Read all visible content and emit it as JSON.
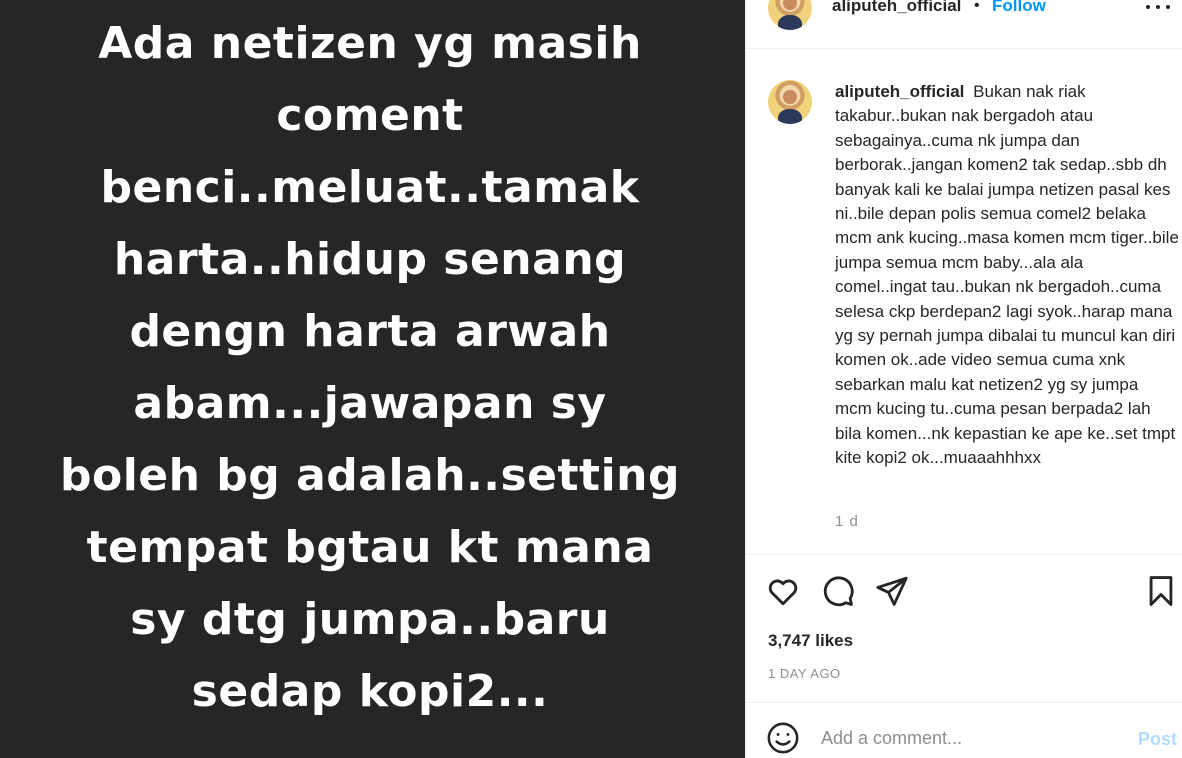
{
  "post_image": {
    "lines": [
      "Ada netizen yg masih",
      "coment",
      "benci..meluat..tamak",
      "harta..hidup senang",
      "dengn harta arwah",
      "abam...jawapan sy",
      "boleh bg adalah..setting",
      "tempat bgtau kt mana",
      "sy dtg jumpa..baru",
      "sedap kopi2..."
    ]
  },
  "header": {
    "username": "aliputeh_official",
    "separator": "•",
    "follow_label": "Follow"
  },
  "caption": {
    "username": "aliputeh_official",
    "text": "Bukan nak riak takabur..bukan nak bergadoh atau sebagainya..cuma nk jumpa dan berborak..jangan komen2 tak sedap..sbb dh banyak kali ke balai jumpa netizen pasal kes ni..bile depan polis semua comel2 belaka mcm ank kucing..masa komen mcm tiger..bile jumpa semua mcm baby...ala ala comel..ingat tau..bukan nk bergadoh..cuma selesa ckp berdepan2 lagi syok..harap mana yg sy pernah jumpa dibalai tu muncul kan diri komen ok..ade video semua cuma xnk sebarkan malu kat netizen2 yg sy jumpa mcm kucing tu..cuma pesan berpada2 lah bila komen...nk kepastian ke ape ke..set tmpt kite kopi2 ok...muaaahhhxx",
    "time": "1 d"
  },
  "actions": {
    "icons": [
      "heart-icon",
      "comment-icon",
      "share-icon",
      "bookmark-icon"
    ]
  },
  "likes_label": "3,747 likes",
  "time_ago": "1 DAY AGO",
  "comment_box": {
    "placeholder": "Add a comment...",
    "post_label": "Post"
  },
  "colors": {
    "accent": "#0095f6",
    "post_disabled": "#b3dbff",
    "image_bg": "#262626"
  }
}
